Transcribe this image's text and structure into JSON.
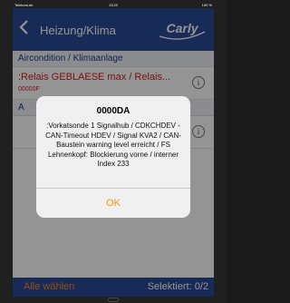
{
  "status_bar": {
    "carrier": "Telekom.de",
    "time": "13:22",
    "battery": "100 %"
  },
  "nav": {
    "title": "Heizung/Klima",
    "logo_text": "Carly"
  },
  "sections": [
    {
      "label": "Aircondition / Klimaanlage"
    },
    {
      "label": "A"
    }
  ],
  "error_rows": [
    {
      "title": ":Relais GEBLAESE max / Relais...",
      "code": "00000F"
    }
  ],
  "bottom_bar": {
    "select_all_label": "Alle wählen",
    "selected_label": "Selektiert:",
    "selected_count": "0/2"
  },
  "alert": {
    "title": "0000DA",
    "message": ":Vorkatsonde 1 Signalhub / CDKCHDEV - CAN-Timeout HDEV / Signal KVA2 / CAN-Baustein warning level erreicht / FS Lehnenkopf: Blockierung vorne / interner Index 233",
    "ok_label": "OK"
  },
  "colors": {
    "brand_blue": "#2a4a97",
    "error_red": "#d41c1c",
    "accent_orange": "#f0960e"
  },
  "icons": {
    "back": "chevron-left-icon",
    "info": "info-icon"
  }
}
